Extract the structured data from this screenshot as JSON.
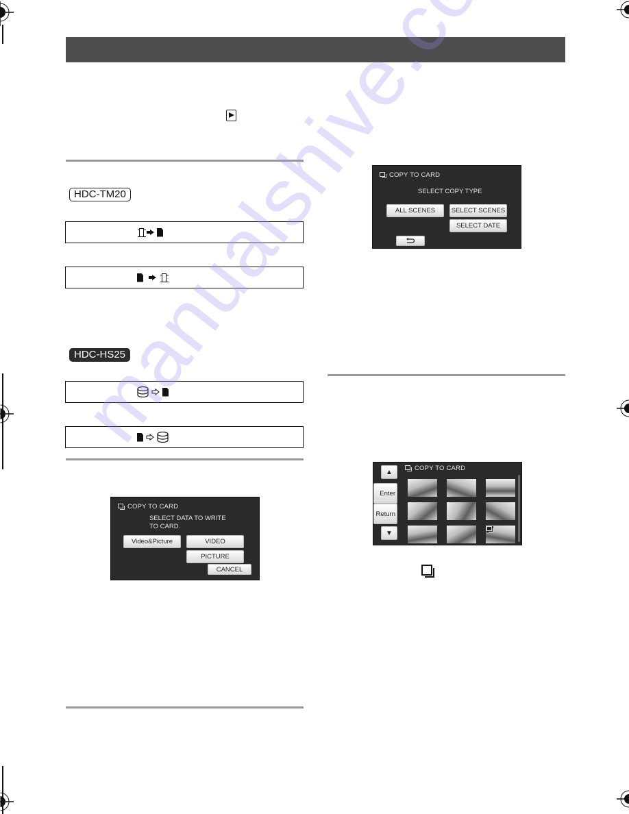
{
  "page": {
    "header_band": "",
    "watermark": "manualshive.com"
  },
  "left_column": {
    "models": [
      {
        "name": "HDC-TM20",
        "style": "outline",
        "rows": [
          {
            "from_icon": "built-in-memory-icon",
            "arrow": "solid-arrow-icon",
            "to_icon": "sd-card-icon"
          },
          {
            "from_icon": "sd-card-icon",
            "arrow": "solid-arrow-icon",
            "to_icon": "built-in-memory-icon"
          }
        ]
      },
      {
        "name": "HDC-HS25",
        "style": "solid",
        "rows": [
          {
            "from_icon": "hdd-icon",
            "arrow": "hollow-arrow-icon",
            "to_icon": "sd-card-icon"
          },
          {
            "from_icon": "sd-card-icon",
            "arrow": "hollow-arrow-icon",
            "to_icon": "hdd-icon"
          }
        ]
      }
    ],
    "screen_select_data": {
      "title": "COPY TO CARD",
      "message_line1": "SELECT DATA TO WRITE",
      "message_line2": "TO CARD.",
      "buttons": {
        "video_picture": "Video&Picture",
        "video": "VIDEO",
        "picture": "PICTURE",
        "cancel": "CANCEL"
      }
    }
  },
  "right_column": {
    "screen_copy_type": {
      "title": "COPY TO CARD",
      "message": "SELECT COPY TYPE",
      "buttons": {
        "all_scenes": "ALL SCENES",
        "select_scenes": "SELECT SCENES",
        "select_date": "SELECT DATE",
        "back": "⮌"
      }
    },
    "screen_thumbnails": {
      "title": "COPY TO CARD",
      "buttons": {
        "up": "▲",
        "enter": "Enter",
        "return": "Return",
        "down": "▼"
      },
      "thumbnail_count": 9,
      "selected_index": 8
    },
    "copy_icon": "copy-icon"
  }
}
